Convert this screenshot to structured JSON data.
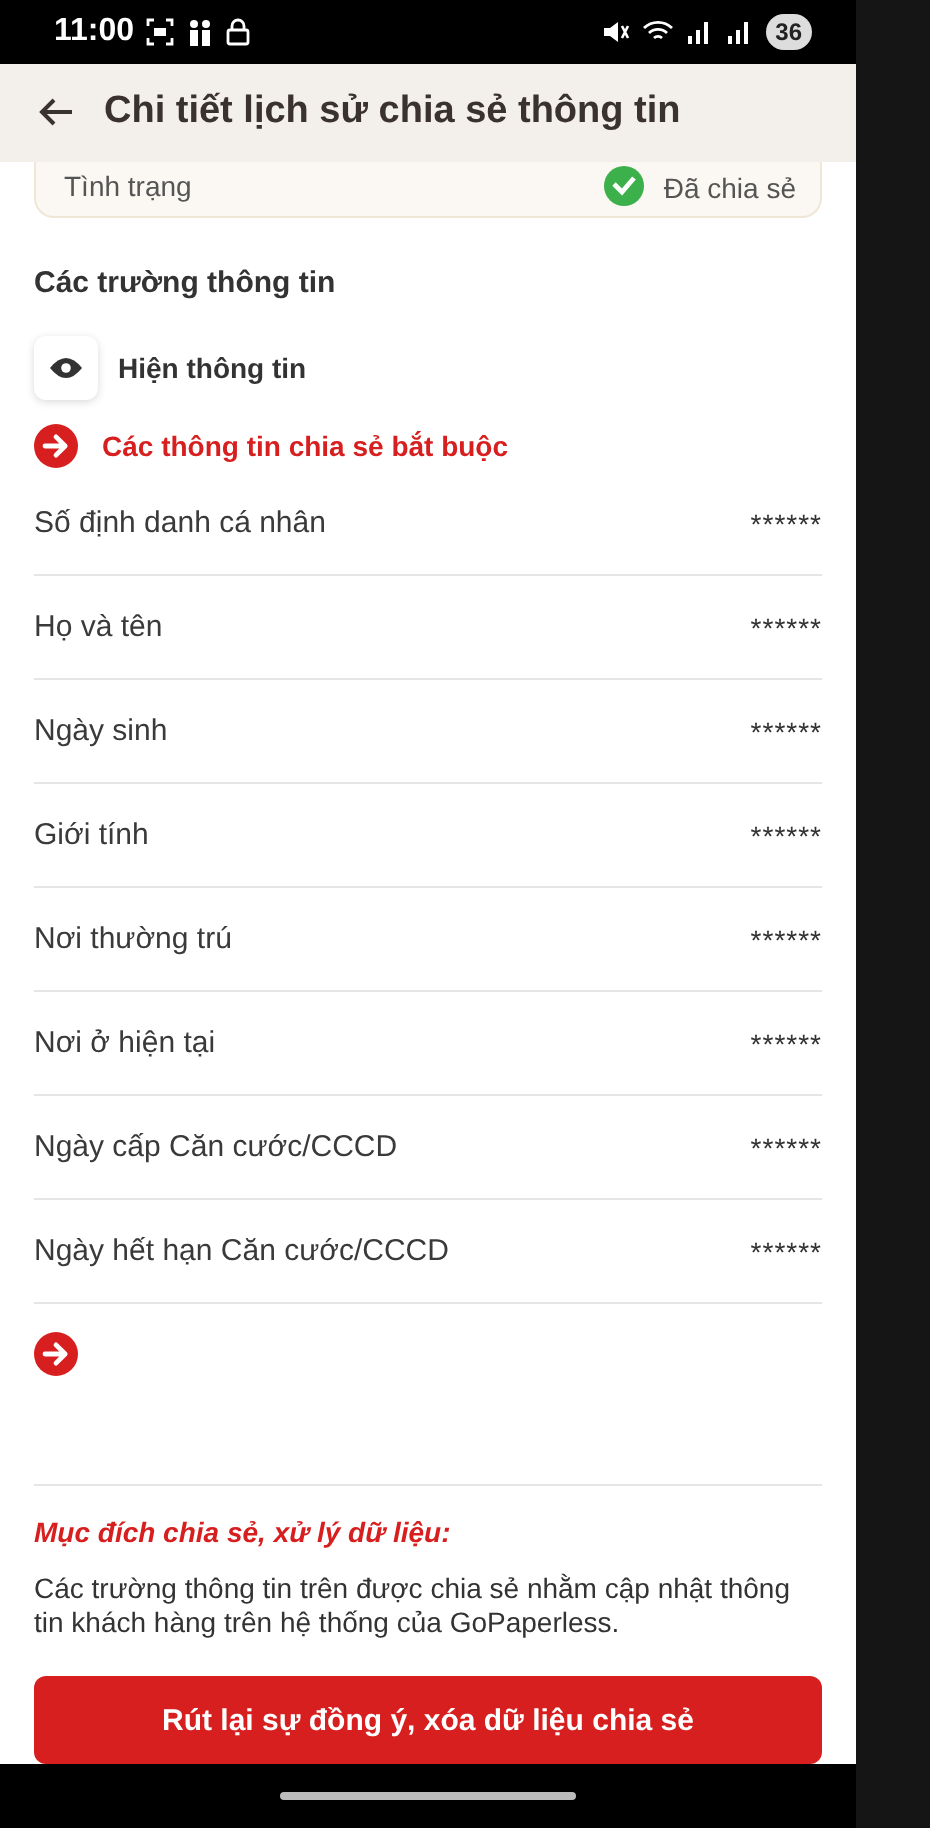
{
  "status_bar": {
    "time": "11:00",
    "battery": "36"
  },
  "header": {
    "title": "Chi tiết lịch sử chia sẻ thông tin"
  },
  "status_card": {
    "label": "Tình trạng",
    "value": "Đã chia sẻ"
  },
  "section_title": "Các trường thông tin",
  "visibility_toggle": {
    "label": "Hiện thông tin"
  },
  "required_group": {
    "title": "Các thông tin chia sẻ bắt buộc",
    "fields": [
      {
        "name": "Số định danh cá nhân",
        "value": "******"
      },
      {
        "name": "Họ và tên",
        "value": "******"
      },
      {
        "name": "Ngày sinh",
        "value": "******"
      },
      {
        "name": "Giới tính",
        "value": "******"
      },
      {
        "name": "Nơi thường trú",
        "value": "******"
      },
      {
        "name": "Nơi ở hiện tại",
        "value": "******"
      },
      {
        "name": "Ngày cấp Căn cước/CCCD",
        "value": "******"
      },
      {
        "name": "Ngày hết hạn Căn cước/CCCD",
        "value": "******"
      }
    ]
  },
  "purpose": {
    "title": "Mục đích chia sẻ, xử lý dữ liệu:",
    "text": "Các trường thông tin trên được chia sẻ nhằm cập nhật thông tin khách hàng trên hệ thống của GoPaperless."
  },
  "withdraw_button": "Rút lại sự đồng ý, xóa dữ liệu chia sẻ"
}
